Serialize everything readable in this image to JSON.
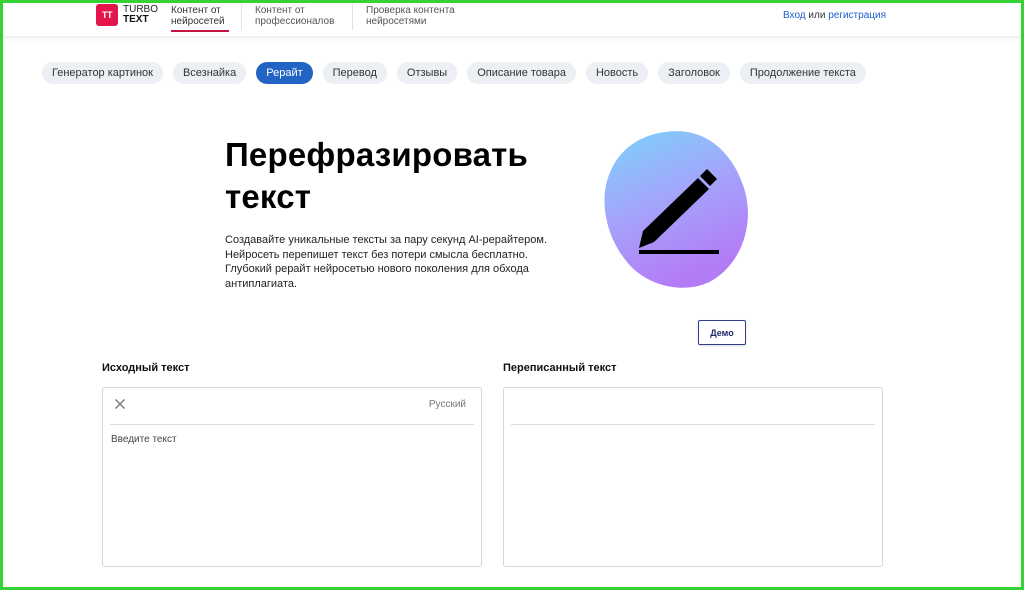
{
  "logo": {
    "badge": "TT",
    "line1": "TURBO",
    "line2": "TEXT"
  },
  "nav": {
    "item1": {
      "line1": "Контент от",
      "line2": "нейросетей"
    },
    "item2": {
      "line1": "Контент от",
      "line2": "профессионалов"
    },
    "item3": {
      "line1": "Проверка контента",
      "line2": "нейросетями"
    }
  },
  "auth": {
    "login": "Вход",
    "or": "или",
    "register": "регистрация"
  },
  "tabs": [
    "Генератор картинок",
    "Всезнайка",
    "Рерайт",
    "Перевод",
    "Отзывы",
    "Описание товара",
    "Новость",
    "Заголовок",
    "Продолжение текста"
  ],
  "active_tab": "Рерайт",
  "hero": {
    "title_line1": "Перефразировать",
    "title_line2": "текст",
    "desc_line1": "Создавайте уникальные тексты за пару секунд AI-рерайтером.",
    "desc_line2": "Нейросеть перепишет текст без потери смысла бесплатно.",
    "desc_line3": "Глубокий рерайт нейросетью нового поколения для обхода",
    "desc_line4": "антиплагиата."
  },
  "demo_button": "Демо",
  "source_panel": {
    "label": "Исходный текст",
    "language": "Русский",
    "placeholder": "Введите текст"
  },
  "result_panel": {
    "label": "Переписанный текст"
  },
  "icons": {
    "close": "close-icon",
    "pen": "pen-icon"
  },
  "colors": {
    "brand": "#e4154b",
    "accent": "#2264c4",
    "nav_underline": "#c2163f"
  }
}
